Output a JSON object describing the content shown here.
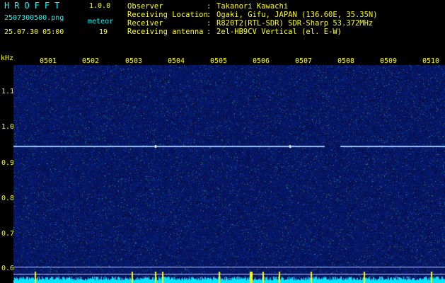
{
  "header": {
    "title_letters": "HROFFT",
    "version": "1.0.0",
    "filename": "2507300500.png",
    "meteor_label": "meteor",
    "datetime": "25.07.30 05:00",
    "meteor_count": "19",
    "fields": [
      {
        "label": "Observer",
        "value": "Takanori Kawachi"
      },
      {
        "label": "Receiving Location",
        "value": "Ogaki, Gifu, JAPAN (136.60E, 35.35N)"
      },
      {
        "label": "Receiver",
        "value": "R820T2(RTL-SDR) SDR-Sharp 53.372MHz"
      },
      {
        "label": "Receiving antenna",
        "value": "2el-HB9CV Vertical (el. E-W)"
      }
    ],
    "colon": ":"
  },
  "axis": {
    "y_unit": "kHz",
    "y_ticks": [
      "1.1",
      "1.0",
      "0.9",
      "0.8",
      "0.7",
      "0.6"
    ],
    "x_ticks": [
      "0501",
      "0502",
      "0503",
      "0504",
      "0505",
      "0506",
      "0507",
      "0508",
      "0509",
      "0510"
    ]
  },
  "colors": {
    "background": "#000000",
    "spectrogram_bg": "#00005a",
    "text_cyan": "#00ffff",
    "text_yellow": "#ffff00",
    "signal_line": "#a0c8ff",
    "meteor_marker": "#ffff00",
    "noise_bar": "#00e6ff"
  },
  "chart_data": {
    "type": "heatmap",
    "x_unit": "minute (HHMM)",
    "y_unit": "kHz",
    "ylim": [
      0.58,
      1.2
    ],
    "xlim": [
      "0500",
      "0510"
    ],
    "carrier_khz": 0.96,
    "reference_lines_khz": [
      0.62,
      0.6
    ]
  }
}
